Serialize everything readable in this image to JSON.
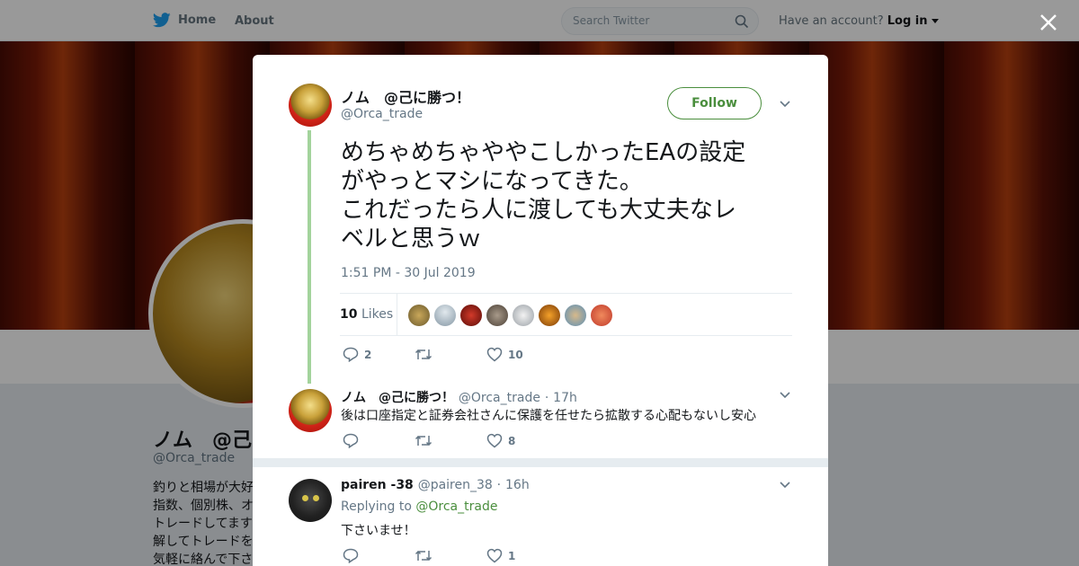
{
  "nav": {
    "home_label": "Home",
    "about_label": "About",
    "search_placeholder": "Search Twitter",
    "have_account": "Have an account?",
    "login_label": "Log in"
  },
  "background_profile": {
    "name": "ノム　@己に勝つ！",
    "handle": "@Orca_trade",
    "bio_lines": [
      "釣りと相場が大好",
      "指数、個別株、オ",
      "トレードしてます",
      "解してトレードを",
      "気軽に絡んで下さ"
    ]
  },
  "tweet": {
    "author_name": "ノム　@己に勝つ！",
    "author_handle": "@Orca_trade",
    "follow_label": "Follow",
    "text_lines": [
      "めちゃめちゃややこしかったEAの設定",
      "がやっとマシになってきた。",
      "これだったら人に渡しても大丈夫なレ",
      "ベルと思うｗ"
    ],
    "timestamp": "1:51 PM - 30 Jul 2019",
    "likes_count": "10",
    "likes_label": "Likes",
    "reply_count": "2",
    "retweet_count": "",
    "like_count": "10"
  },
  "replies": [
    {
      "author_name": "ノム　@己に勝つ！",
      "author_handle": "@Orca_trade",
      "time": "17h",
      "text": "後は口座指定と証券会社さんに保護を任せたら拡散する心配もないし安心",
      "like_count": "8"
    },
    {
      "author_name": "pairen -38",
      "author_handle": "@pairen_38",
      "time": "16h",
      "replying_to_label": "Replying to",
      "replying_to_handle": "@Orca_trade",
      "text": "下さいませ！",
      "like_count": "1"
    }
  ],
  "colors": {
    "accent_green": "#4a8e3d",
    "thread_line": "#a3d39c",
    "twitter_blue": "#1da1f2"
  }
}
